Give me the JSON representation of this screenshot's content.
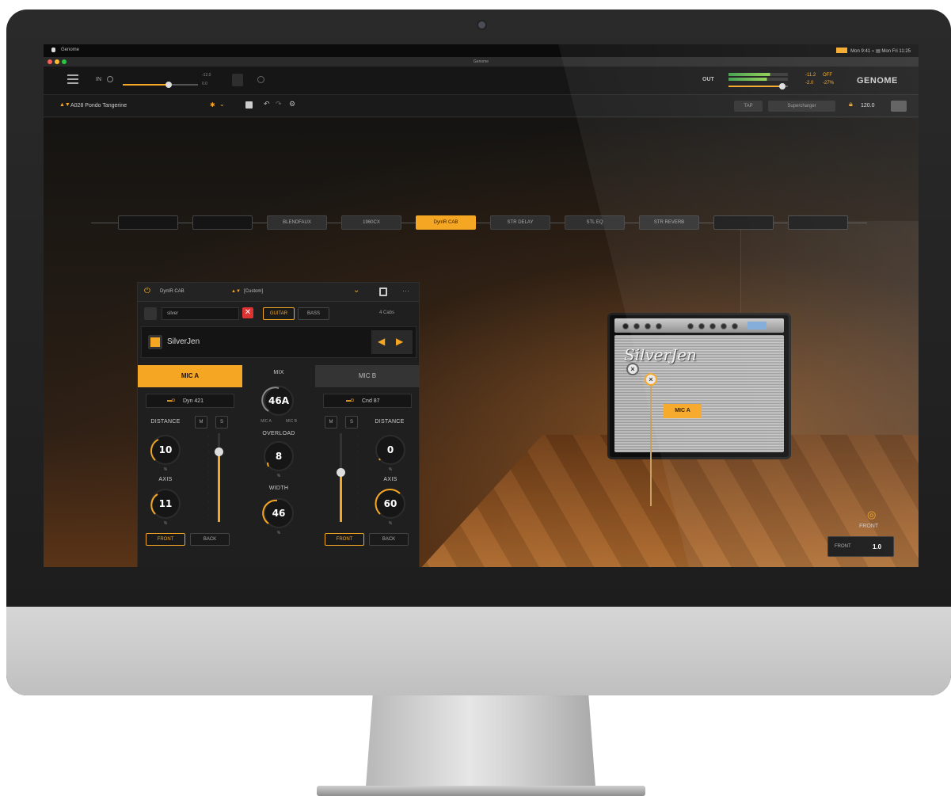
{
  "menubar": {
    "app_name": "Genome",
    "status_text": "Mon 9:41  ⌁  ▤  Mon Fri 11:25"
  },
  "titlebar": {
    "title": "Genome"
  },
  "input": {
    "label": "IN",
    "value_top": "-12.0",
    "value_bottom": "0.0"
  },
  "output": {
    "label": "OUT",
    "value_a": "-11.2",
    "value_b": "-2.0",
    "value_c": "OFF",
    "value_d": "-27%"
  },
  "brand": {
    "logo": "GENOME"
  },
  "preset": {
    "name": "A028 Pondo Tangerine",
    "tuner_label": "TAP",
    "bpm_label": "Supercharger",
    "bpm_value": "120.0"
  },
  "chain": {
    "slots": [
      {
        "label": ""
      },
      {
        "label": ""
      },
      {
        "label": "BLENDFAUX"
      },
      {
        "label": "1960CX"
      },
      {
        "label": "DynIR CAB"
      },
      {
        "label": "STR DELAY"
      },
      {
        "label": "STL EQ"
      },
      {
        "label": "STR REVERB"
      },
      {
        "label": ""
      },
      {
        "label": ""
      }
    ]
  },
  "panel": {
    "module_name": "DynIR CAB",
    "preset_select": "[Custom]",
    "search_value": "silver",
    "filter_guitar": "GUITAR",
    "filter_bass": "BASS",
    "cab_count": "4 Cabs",
    "cab_name": "SilverJen",
    "mic_a": {
      "tab": "MIC A",
      "mic_model": "Dyn 421",
      "distance_label": "DISTANCE",
      "m_btn": "M",
      "s_btn": "S",
      "distance_value": "10",
      "distance_unit": "%",
      "axis_label": "AXIS",
      "axis_value": "11",
      "axis_unit": "%",
      "front_btn": "FRONT",
      "back_btn": "BACK"
    },
    "mix": {
      "label": "MIX",
      "value": "46A",
      "left_tag": "MIC A",
      "right_tag": "MIC B",
      "overload_label": "OVERLOAD",
      "overload_value": "8",
      "overload_unit": "%",
      "width_label": "WIDTH",
      "width_value": "46",
      "width_unit": "%"
    },
    "mic_b": {
      "tab": "MIC B",
      "mic_model": "Cnd 87",
      "distance_label": "DISTANCE",
      "m_btn": "M",
      "s_btn": "S",
      "distance_value": "0",
      "distance_unit": "%",
      "axis_label": "AXIS",
      "axis_value": "60",
      "axis_unit": "%",
      "front_btn": "FRONT",
      "back_btn": "BACK"
    }
  },
  "amp": {
    "logo": "SilverJen",
    "mic_label": "MIC A"
  },
  "view": {
    "front_label": "FRONT",
    "front_value": "1.0"
  },
  "colors": {
    "accent": "#f5a623",
    "panel_bg": "#1f1f1f"
  }
}
